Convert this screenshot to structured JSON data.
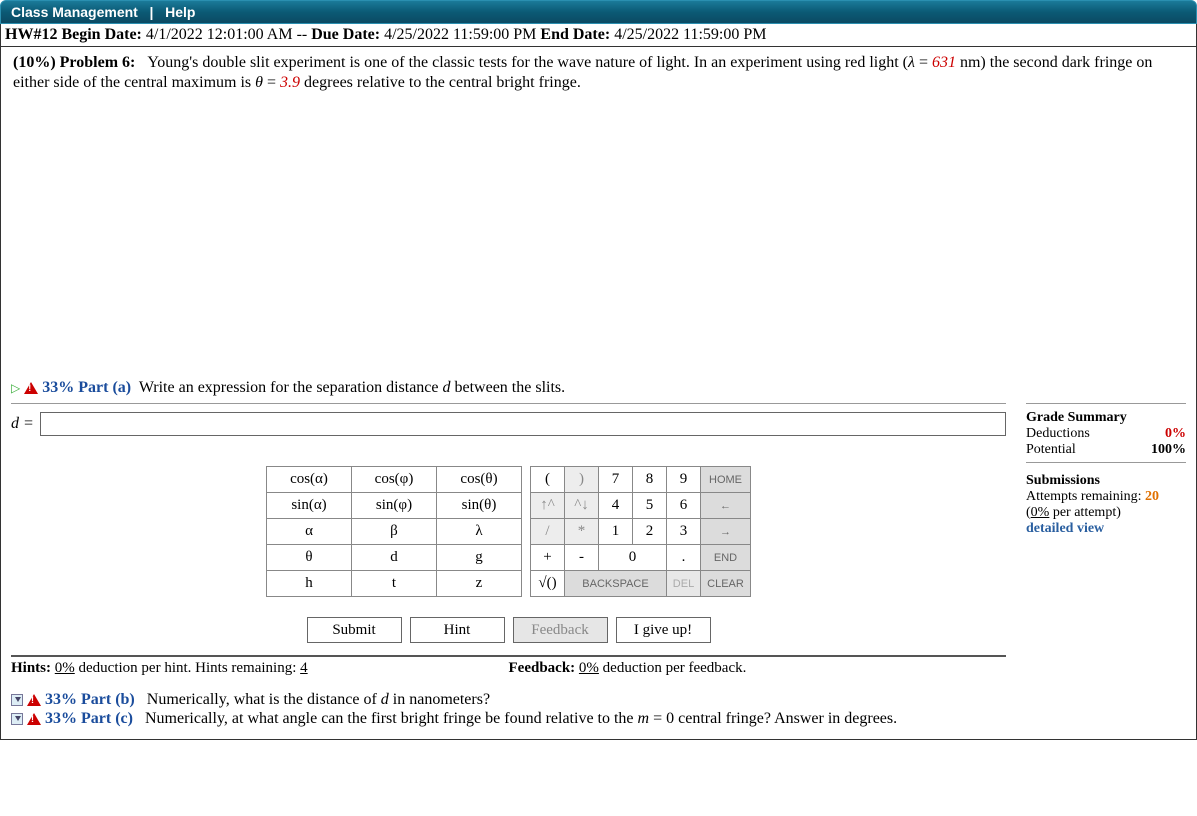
{
  "topbar": {
    "class_management": "Class Management",
    "sep": "|",
    "help": "Help"
  },
  "datebar": {
    "hw_label": "HW#12 Begin Date:",
    "begin_date": "4/1/2022 12:01:00 AM",
    "mid_sep": "--",
    "due_label": "Due Date:",
    "due_date": "4/25/2022 11:59:00 PM",
    "end_label": "End Date:",
    "end_date": "4/25/2022 11:59:00 PM"
  },
  "problem": {
    "prefix": "(10%) Problem 6:",
    "text_1": "Young's double slit experiment is one of the classic tests for the wave nature of light. In an experiment using red light (",
    "lambda_sym": "λ",
    "eq": " = ",
    "lambda_val": "631",
    "lambda_unit": " nm",
    "text_2": ") the second dark fringe on either side of the central maximum is ",
    "theta_sym": "θ",
    "theta_val": "3.9",
    "text_3": " degrees relative to the central bright fringe."
  },
  "part_a": {
    "percent": "33% Part (a)",
    "prompt": "Write an expression for the separation distance d between the slits."
  },
  "answer": {
    "lhs": "d =",
    "value": ""
  },
  "funcpad": {
    "r0c0": "cos(α)",
    "r0c1": "cos(φ)",
    "r0c2": "cos(θ)",
    "r1c0": "sin(α)",
    "r1c1": "sin(φ)",
    "r1c2": "sin(θ)",
    "r2c0": "α",
    "r2c1": "β",
    "r2c2": "λ",
    "r3c0": "θ",
    "r3c1": "d",
    "r3c2": "g",
    "r4c0": "h",
    "r4c1": "t",
    "r4c2": "z"
  },
  "numpad": {
    "lparen": "(",
    "rparen": ")",
    "n7": "7",
    "n8": "8",
    "n9": "9",
    "home": "HOME",
    "up": "↑^",
    "down": "^↓",
    "n4": "4",
    "n5": "5",
    "n6": "6",
    "back": "←",
    "slash": "/",
    "star": "*",
    "n1": "1",
    "n2": "2",
    "n3": "3",
    "fwd": "→",
    "plus": "+",
    "minus": "-",
    "n0": "0",
    "dot": ".",
    "end": "END",
    "sqrt": "√()",
    "bksp": "BACKSPACE",
    "del": "DEL",
    "clear": "CLEAR"
  },
  "actions": {
    "submit": "Submit",
    "hint": "Hint",
    "feedback": "Feedback",
    "giveup": "I give up!"
  },
  "hints": {
    "label": "Hints:",
    "pct": "0%",
    "txt": " deduction per hint. Hints remaining: ",
    "rem": "4"
  },
  "fbinfo": {
    "label": "Feedback:",
    "pct": "0%",
    "txt": " deduction per feedback."
  },
  "grade": {
    "title": "Grade Summary",
    "ded_l": "Deductions",
    "ded_v": "0%",
    "pot_l": "Potential",
    "pot_v": "100%"
  },
  "subs": {
    "title": "Submissions",
    "attempts_l": "Attempts remaining: ",
    "attempts_v": "20",
    "per_1": "(",
    "per_pct": "0%",
    "per_2": " per attempt)",
    "detail": "detailed view"
  },
  "part_b": {
    "percent": "33% Part (b)",
    "prompt": "Numerically, what is the distance of d in nanometers?"
  },
  "part_c": {
    "percent": "33% Part (c)",
    "prompt": "Numerically, at what angle can the first bright fringe be found relative to the m = 0 central fringe? Answer in degrees."
  }
}
